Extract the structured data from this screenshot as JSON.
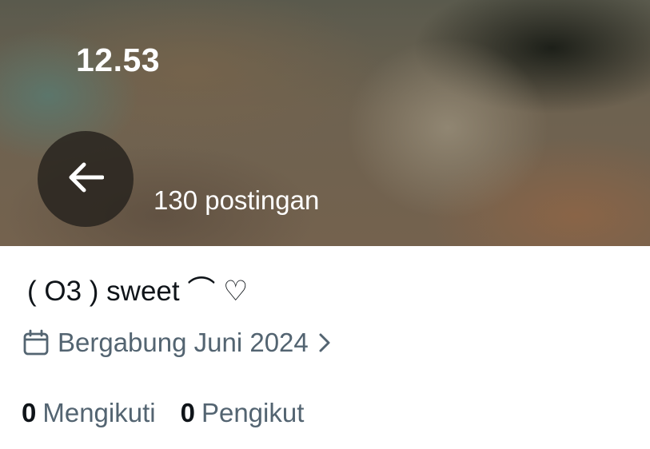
{
  "status_bar": {
    "time": "12.53"
  },
  "header": {
    "post_count": "130 postingan",
    "back_icon": "arrow-left-icon"
  },
  "profile": {
    "display_name": "( O3 ) sweet ⌒ ♡",
    "joined": {
      "icon": "calendar-icon",
      "text": "Bergabung Juni 2024",
      "chevron_icon": "chevron-right-icon"
    },
    "following": {
      "count": "0",
      "label": "Mengikuti"
    },
    "followers": {
      "count": "0",
      "label": "Pengikut"
    }
  },
  "colors": {
    "text_primary": "#0f1419",
    "text_secondary": "#536471",
    "back_button_bg": "#2a2620"
  }
}
